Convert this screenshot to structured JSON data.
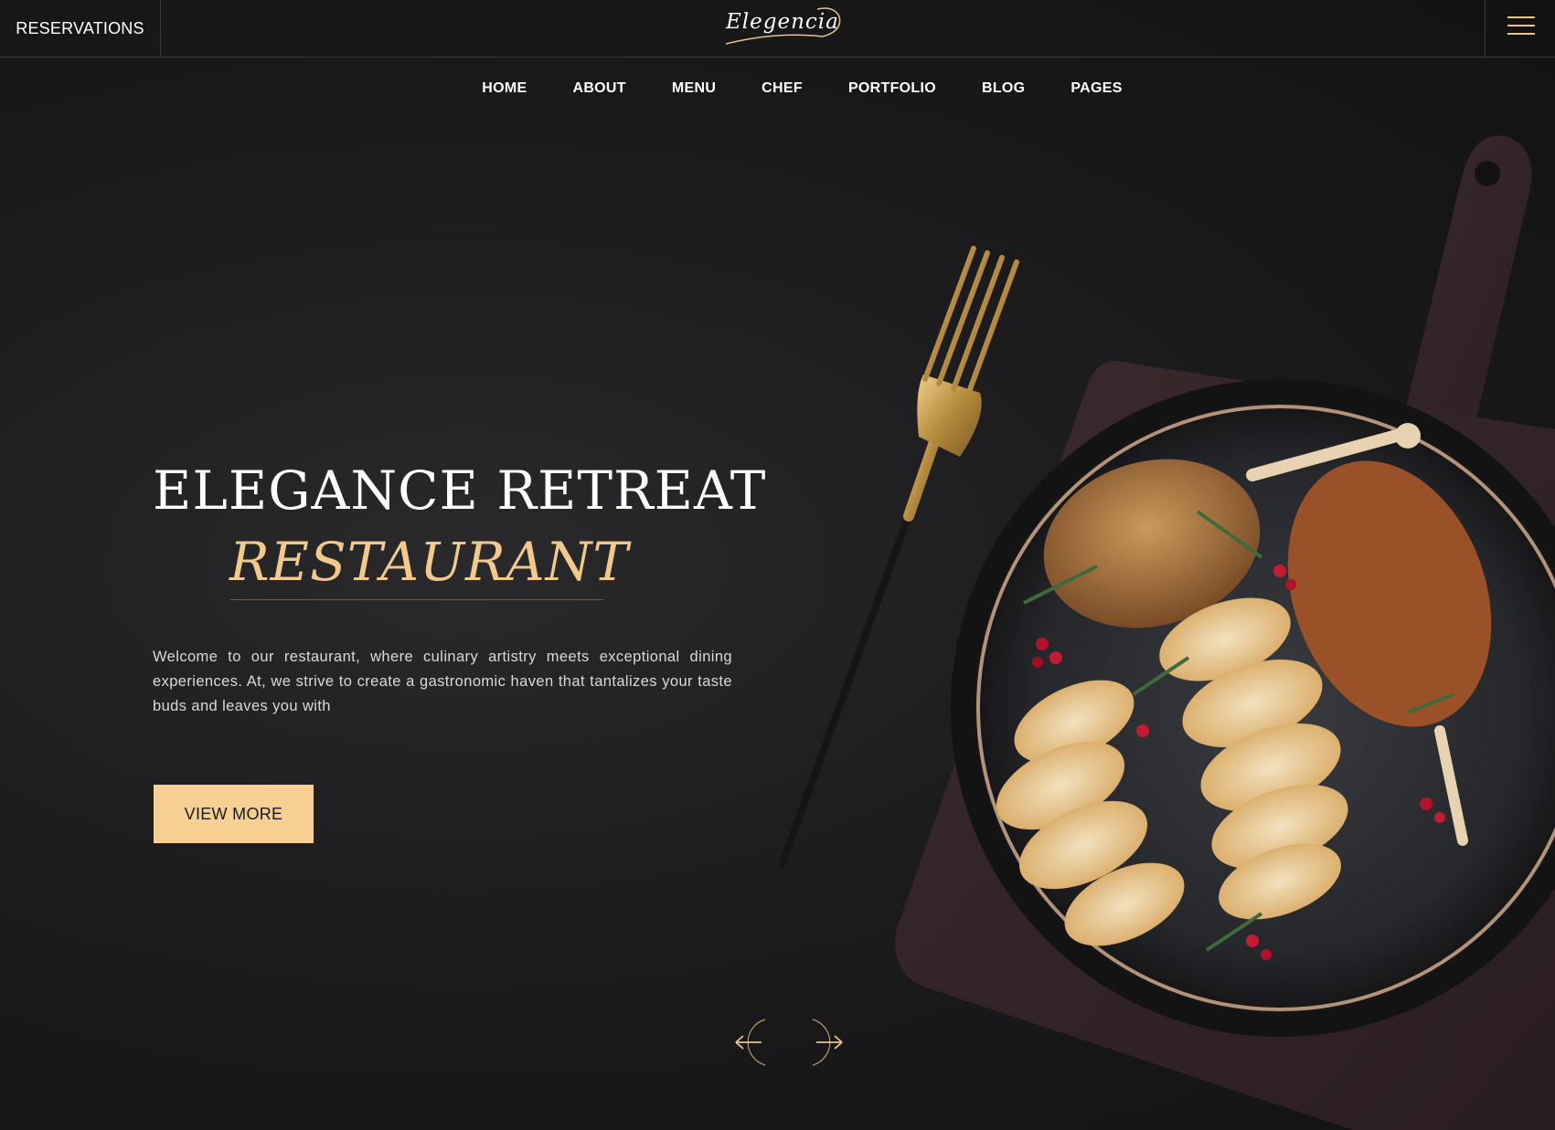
{
  "header": {
    "reservations_label": "RESERVATIONS",
    "logo_text": "Elegencia",
    "menu_icon": "hamburger-icon"
  },
  "nav": {
    "items": [
      {
        "label": "HOME"
      },
      {
        "label": "ABOUT"
      },
      {
        "label": "MENU"
      },
      {
        "label": "CHEF"
      },
      {
        "label": "PORTFOLIO"
      },
      {
        "label": "BLOG"
      },
      {
        "label": "PAGES"
      }
    ]
  },
  "hero": {
    "title": "ELEGANCE RETREAT",
    "subtitle": "RESTAURANT",
    "description": "Welcome to our restaurant, where culinary artistry meets exceptional dining experiences. At, we strive to create a gastronomic haven that tantalizes your taste buds and leaves you with",
    "button_label": "VIEW MORE"
  },
  "slider": {
    "prev_icon": "arrow-left-icon",
    "next_icon": "arrow-right-icon"
  },
  "colors": {
    "accent": "#f1c98b",
    "button_bg": "#f6cf92",
    "background": "#1a1a1c"
  }
}
